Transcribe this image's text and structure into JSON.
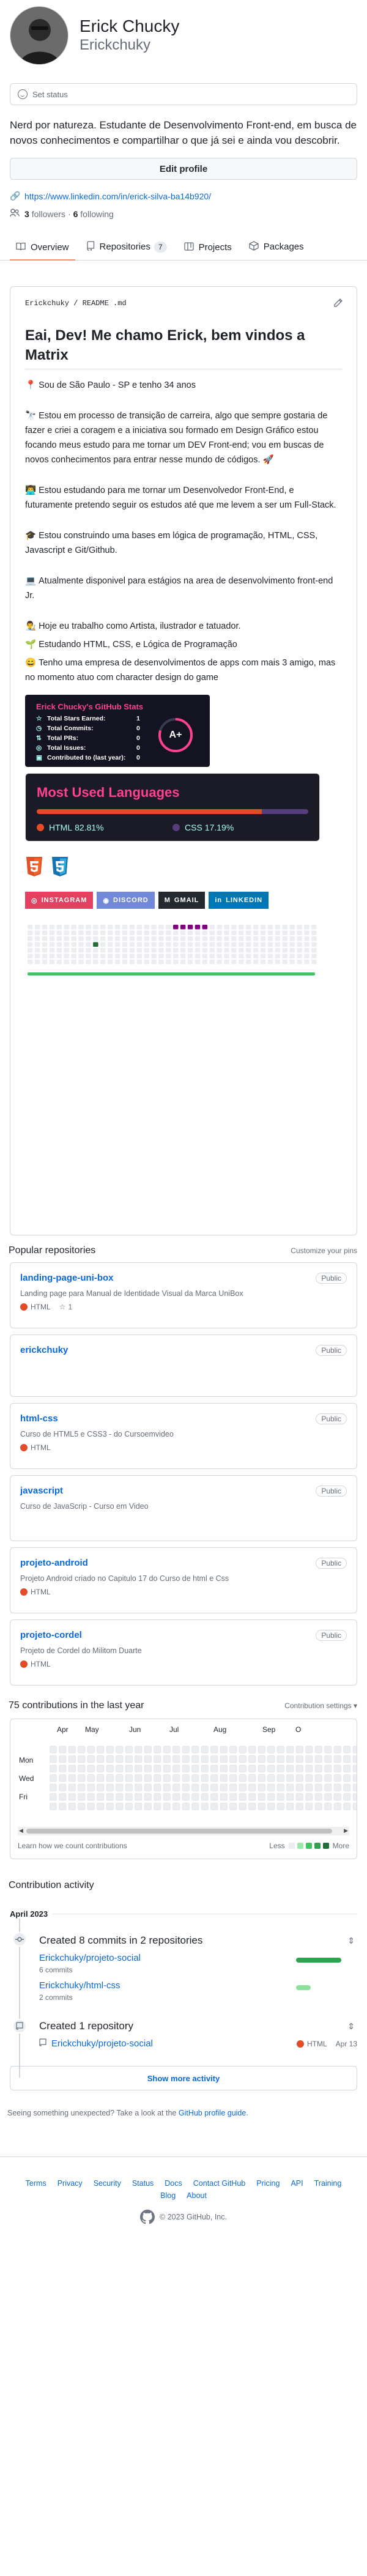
{
  "profile": {
    "fullname": "Erick Chucky",
    "username": "Erickchuky",
    "status_placeholder": "Set status",
    "bio": "Nerd por natureza. Estudante de Desenvolvimento Front-end, em busca de novos conhecimentos e compartilhar o que já sei e ainda vou descobrir.",
    "edit_label": "Edit profile",
    "link": "https://www.linkedin.com/in/erick-silva-ba14b920/",
    "followers_count": "3",
    "followers_label": "followers",
    "following_count": "6",
    "following_label": "following"
  },
  "tabs": [
    {
      "label": "Overview",
      "icon": "book-icon"
    },
    {
      "label": "Repositories",
      "count": "7",
      "icon": "repo-icon"
    },
    {
      "label": "Projects",
      "icon": "table-icon"
    },
    {
      "label": "Packages",
      "icon": "package-icon"
    }
  ],
  "readme": {
    "path": "Erickchuky / README .md",
    "title": "Eai, Dev! Me chamo Erick, bem vindos a Matrix",
    "lines": [
      {
        "emoji": "📍",
        "text": "Sou de São Paulo - SP e tenho 34 anos"
      },
      {
        "emoji": "🔭",
        "text": "Estou em processo de transição de carreira, algo que sempre gostaria de fazer e criei a coragem e a iniciativa sou formado em Design Gráfico estou focando meus estudo para me tornar um DEV Front-end; vou em buscas de novos conhecimentos para entrar nesse mundo de códigos. 🚀"
      },
      {
        "emoji": "👨‍💻",
        "text": "Estou estudando para me tornar um Desenvolvedor Front-End, e futuramente pretendo seguir os estudos até que me levem a ser um Full-Stack."
      },
      {
        "emoji": "🎓",
        "text": "Estou construindo uma bases em lógica de programação, HTML, CSS, Javascript e Git/Github."
      },
      {
        "emoji": "💻",
        "text": "Atualmente disponivel para estágios na area de desenvolvimento front-end Jr."
      },
      {
        "emoji": "👨‍🎨",
        "text": "Hoje eu trabalho como Artista, ilustrador e tatuador."
      },
      {
        "emoji": "🌱",
        "text": "Estudando HTML, CSS, e Lógica de Programação"
      },
      {
        "emoji": "😄",
        "text": "Tenho uma empresa de desenvolvimentos de apps com mais 3 amigo, mas no momento atuo com character design do game"
      }
    ],
    "stats": {
      "title": "Erick Chucky's GitHub Stats",
      "rows": [
        {
          "label": "Total Stars Earned:",
          "value": "1"
        },
        {
          "label": "Total Commits:",
          "value": "0"
        },
        {
          "label": "Total PRs:",
          "value": "0"
        },
        {
          "label": "Total Issues:",
          "value": "0"
        },
        {
          "label": "Contributed to (last year):",
          "value": "0"
        }
      ],
      "grade": "A+"
    },
    "languages": {
      "title": "Most Used Languages",
      "items": [
        {
          "name": "HTML",
          "percent": "82.81%",
          "fraction": 0.8281,
          "color": "#e34c26"
        },
        {
          "name": "CSS",
          "percent": "17.19%",
          "fraction": 0.1719,
          "color": "#563d7c"
        }
      ]
    },
    "social": [
      {
        "label": "INSTAGRAM",
        "color": "#e4405f",
        "icon": "instagram-icon"
      },
      {
        "label": "DISCORD",
        "color": "#7289da",
        "icon": "discord-icon"
      },
      {
        "label": "GMAIL",
        "color": "#24292f",
        "icon": "gmail-icon"
      },
      {
        "label": "LINKEDIN",
        "color": "#0077b5",
        "icon": "linkedin-icon"
      }
    ]
  },
  "popular": {
    "title": "Popular repositories",
    "customize": "Customize your pins",
    "repos": [
      {
        "name": "landing-page-uni-box",
        "visibility": "Public",
        "desc": "Landing page para Manual de Identidade Visual da Marca UniBox",
        "lang": "HTML",
        "stars": "1"
      },
      {
        "name": "erickchuky",
        "visibility": "Public",
        "desc": "",
        "lang": "",
        "stars": ""
      },
      {
        "name": "html-css",
        "visibility": "Public",
        "desc": "Curso de HTML5 e CSS3 - do Cursoemvideo",
        "lang": "HTML",
        "stars": ""
      },
      {
        "name": "javascript",
        "visibility": "Public",
        "desc": "Curso de JavaScrip - Curso em Video",
        "lang": "",
        "stars": ""
      },
      {
        "name": "projeto-android",
        "visibility": "Public",
        "desc": "Projeto Android criado no Capitulo 17 do Curso de html e Css",
        "lang": "HTML",
        "stars": ""
      },
      {
        "name": "projeto-cordel",
        "visibility": "Public",
        "desc": "Projeto de Cordel do Militom Duarte",
        "lang": "HTML",
        "stars": ""
      }
    ]
  },
  "contributions": {
    "title": "75 contributions in the last year",
    "settings": "Contribution settings",
    "months": [
      "Apr",
      "May",
      "Jun",
      "Jul",
      "Aug",
      "Sep",
      "O"
    ],
    "days": [
      "Mon",
      "Wed",
      "Fri"
    ],
    "learn": "Learn how we count contributions",
    "less": "Less",
    "more": "More",
    "colors": [
      "#ebedf0",
      "#9be9a8",
      "#40c463",
      "#30a14e",
      "#216e39"
    ]
  },
  "activity": {
    "title": "Contribution activity",
    "month": "April 2023",
    "commits_head": "Created 8 commits in 2 repositories",
    "commit_repos": [
      {
        "name": "Erickchuky/projeto-social",
        "count": "6 commits",
        "fraction": 1.0
      },
      {
        "name": "Erickchuky/html-css",
        "count": "2 commits",
        "fraction": 0.33
      }
    ],
    "created_head": "Created 1 repository",
    "created_repo": {
      "name": "Erickchuky/projeto-social",
      "lang": "HTML",
      "date": "Apr 13"
    },
    "show_more": "Show more activity",
    "unexpected_text": "Seeing something unexpected? Take a look at the",
    "unexpected_link": "GitHub profile guide",
    "unexpected_end": "."
  },
  "footer": {
    "links": [
      "Terms",
      "Privacy",
      "Security",
      "Status",
      "Docs",
      "Contact GitHub",
      "Pricing",
      "API",
      "Training",
      "Blog",
      "About"
    ],
    "copyright": "© 2023 GitHub, Inc."
  }
}
